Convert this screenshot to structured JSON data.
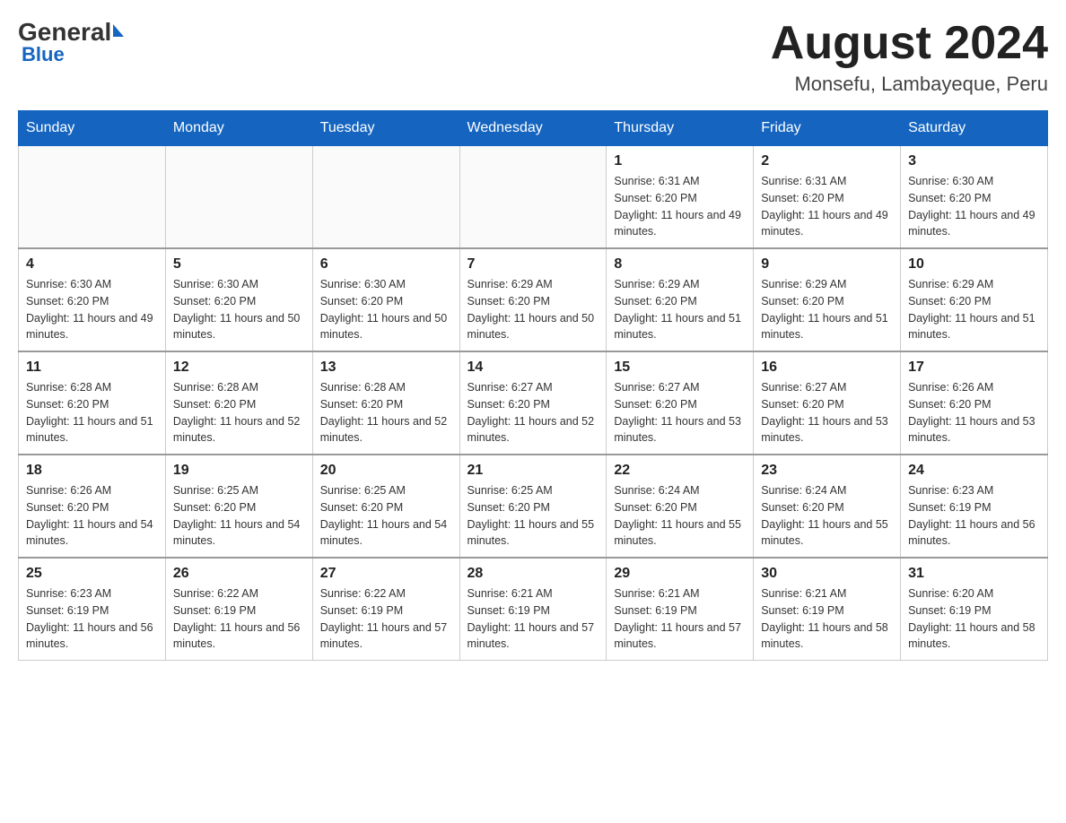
{
  "logo": {
    "general": "General",
    "blue": "Blue"
  },
  "title": {
    "month_year": "August 2024",
    "location": "Monsefu, Lambayeque, Peru"
  },
  "weekdays": [
    "Sunday",
    "Monday",
    "Tuesday",
    "Wednesday",
    "Thursday",
    "Friday",
    "Saturday"
  ],
  "weeks": [
    [
      {
        "day": "",
        "sunrise": "",
        "sunset": "",
        "daylight": ""
      },
      {
        "day": "",
        "sunrise": "",
        "sunset": "",
        "daylight": ""
      },
      {
        "day": "",
        "sunrise": "",
        "sunset": "",
        "daylight": ""
      },
      {
        "day": "",
        "sunrise": "",
        "sunset": "",
        "daylight": ""
      },
      {
        "day": "1",
        "sunrise": "Sunrise: 6:31 AM",
        "sunset": "Sunset: 6:20 PM",
        "daylight": "Daylight: 11 hours and 49 minutes."
      },
      {
        "day": "2",
        "sunrise": "Sunrise: 6:31 AM",
        "sunset": "Sunset: 6:20 PM",
        "daylight": "Daylight: 11 hours and 49 minutes."
      },
      {
        "day": "3",
        "sunrise": "Sunrise: 6:30 AM",
        "sunset": "Sunset: 6:20 PM",
        "daylight": "Daylight: 11 hours and 49 minutes."
      }
    ],
    [
      {
        "day": "4",
        "sunrise": "Sunrise: 6:30 AM",
        "sunset": "Sunset: 6:20 PM",
        "daylight": "Daylight: 11 hours and 49 minutes."
      },
      {
        "day": "5",
        "sunrise": "Sunrise: 6:30 AM",
        "sunset": "Sunset: 6:20 PM",
        "daylight": "Daylight: 11 hours and 50 minutes."
      },
      {
        "day": "6",
        "sunrise": "Sunrise: 6:30 AM",
        "sunset": "Sunset: 6:20 PM",
        "daylight": "Daylight: 11 hours and 50 minutes."
      },
      {
        "day": "7",
        "sunrise": "Sunrise: 6:29 AM",
        "sunset": "Sunset: 6:20 PM",
        "daylight": "Daylight: 11 hours and 50 minutes."
      },
      {
        "day": "8",
        "sunrise": "Sunrise: 6:29 AM",
        "sunset": "Sunset: 6:20 PM",
        "daylight": "Daylight: 11 hours and 51 minutes."
      },
      {
        "day": "9",
        "sunrise": "Sunrise: 6:29 AM",
        "sunset": "Sunset: 6:20 PM",
        "daylight": "Daylight: 11 hours and 51 minutes."
      },
      {
        "day": "10",
        "sunrise": "Sunrise: 6:29 AM",
        "sunset": "Sunset: 6:20 PM",
        "daylight": "Daylight: 11 hours and 51 minutes."
      }
    ],
    [
      {
        "day": "11",
        "sunrise": "Sunrise: 6:28 AM",
        "sunset": "Sunset: 6:20 PM",
        "daylight": "Daylight: 11 hours and 51 minutes."
      },
      {
        "day": "12",
        "sunrise": "Sunrise: 6:28 AM",
        "sunset": "Sunset: 6:20 PM",
        "daylight": "Daylight: 11 hours and 52 minutes."
      },
      {
        "day": "13",
        "sunrise": "Sunrise: 6:28 AM",
        "sunset": "Sunset: 6:20 PM",
        "daylight": "Daylight: 11 hours and 52 minutes."
      },
      {
        "day": "14",
        "sunrise": "Sunrise: 6:27 AM",
        "sunset": "Sunset: 6:20 PM",
        "daylight": "Daylight: 11 hours and 52 minutes."
      },
      {
        "day": "15",
        "sunrise": "Sunrise: 6:27 AM",
        "sunset": "Sunset: 6:20 PM",
        "daylight": "Daylight: 11 hours and 53 minutes."
      },
      {
        "day": "16",
        "sunrise": "Sunrise: 6:27 AM",
        "sunset": "Sunset: 6:20 PM",
        "daylight": "Daylight: 11 hours and 53 minutes."
      },
      {
        "day": "17",
        "sunrise": "Sunrise: 6:26 AM",
        "sunset": "Sunset: 6:20 PM",
        "daylight": "Daylight: 11 hours and 53 minutes."
      }
    ],
    [
      {
        "day": "18",
        "sunrise": "Sunrise: 6:26 AM",
        "sunset": "Sunset: 6:20 PM",
        "daylight": "Daylight: 11 hours and 54 minutes."
      },
      {
        "day": "19",
        "sunrise": "Sunrise: 6:25 AM",
        "sunset": "Sunset: 6:20 PM",
        "daylight": "Daylight: 11 hours and 54 minutes."
      },
      {
        "day": "20",
        "sunrise": "Sunrise: 6:25 AM",
        "sunset": "Sunset: 6:20 PM",
        "daylight": "Daylight: 11 hours and 54 minutes."
      },
      {
        "day": "21",
        "sunrise": "Sunrise: 6:25 AM",
        "sunset": "Sunset: 6:20 PM",
        "daylight": "Daylight: 11 hours and 55 minutes."
      },
      {
        "day": "22",
        "sunrise": "Sunrise: 6:24 AM",
        "sunset": "Sunset: 6:20 PM",
        "daylight": "Daylight: 11 hours and 55 minutes."
      },
      {
        "day": "23",
        "sunrise": "Sunrise: 6:24 AM",
        "sunset": "Sunset: 6:20 PM",
        "daylight": "Daylight: 11 hours and 55 minutes."
      },
      {
        "day": "24",
        "sunrise": "Sunrise: 6:23 AM",
        "sunset": "Sunset: 6:19 PM",
        "daylight": "Daylight: 11 hours and 56 minutes."
      }
    ],
    [
      {
        "day": "25",
        "sunrise": "Sunrise: 6:23 AM",
        "sunset": "Sunset: 6:19 PM",
        "daylight": "Daylight: 11 hours and 56 minutes."
      },
      {
        "day": "26",
        "sunrise": "Sunrise: 6:22 AM",
        "sunset": "Sunset: 6:19 PM",
        "daylight": "Daylight: 11 hours and 56 minutes."
      },
      {
        "day": "27",
        "sunrise": "Sunrise: 6:22 AM",
        "sunset": "Sunset: 6:19 PM",
        "daylight": "Daylight: 11 hours and 57 minutes."
      },
      {
        "day": "28",
        "sunrise": "Sunrise: 6:21 AM",
        "sunset": "Sunset: 6:19 PM",
        "daylight": "Daylight: 11 hours and 57 minutes."
      },
      {
        "day": "29",
        "sunrise": "Sunrise: 6:21 AM",
        "sunset": "Sunset: 6:19 PM",
        "daylight": "Daylight: 11 hours and 57 minutes."
      },
      {
        "day": "30",
        "sunrise": "Sunrise: 6:21 AM",
        "sunset": "Sunset: 6:19 PM",
        "daylight": "Daylight: 11 hours and 58 minutes."
      },
      {
        "day": "31",
        "sunrise": "Sunrise: 6:20 AM",
        "sunset": "Sunset: 6:19 PM",
        "daylight": "Daylight: 11 hours and 58 minutes."
      }
    ]
  ]
}
